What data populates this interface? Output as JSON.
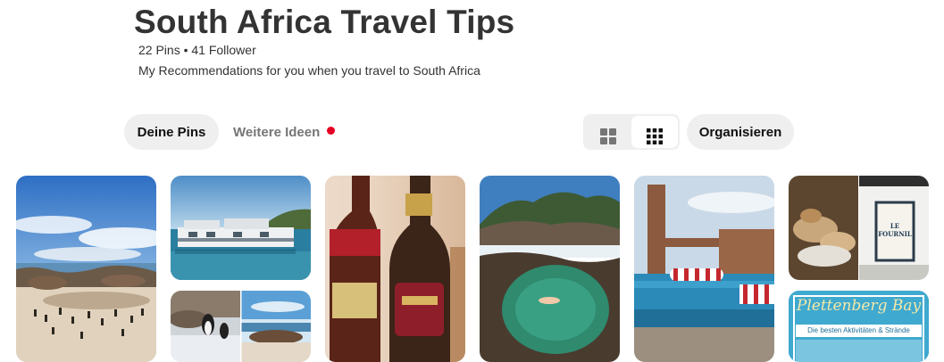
{
  "board": {
    "title": "South Africa Travel Tips",
    "stats": "22 Pins • 41 Follower",
    "description": "My Recommendations for you when you travel to South Africa"
  },
  "tabs": {
    "pins_label": "Deine Pins",
    "ideas_label": "Weitere Ideen",
    "ideas_has_notification": true
  },
  "view_toggle": {
    "options": [
      "default-grid-icon",
      "compact-grid-icon"
    ],
    "selected": "compact-grid-icon"
  },
  "organize_label": "Organisieren",
  "pins": [
    {
      "name": "pin-beach-penguins",
      "icon": "beach-photo"
    },
    {
      "name": "pin-houseboats",
      "icon": "boat-photo"
    },
    {
      "name": "pin-penguins-beach-collage",
      "icon": "collage-photo"
    },
    {
      "name": "pin-wine-bottles",
      "icon": "wine-photo"
    },
    {
      "name": "pin-tidal-pool",
      "icon": "pool-photo"
    },
    {
      "name": "pin-infinity-pool",
      "icon": "pool-photo"
    },
    {
      "name": "pin-bakery-cafe",
      "icon": "bakery-photo",
      "sign_text": "LE FOURNIL"
    },
    {
      "name": "pin-plettenberg-bay",
      "icon": "poster-photo",
      "title": "Plettenberg Bay",
      "subtitle": "Die besten Aktivitäten & Strände"
    }
  ],
  "colors": {
    "notification_dot": "#e60023",
    "pill_bg": "#efefef",
    "secondary_text": "#767676"
  }
}
